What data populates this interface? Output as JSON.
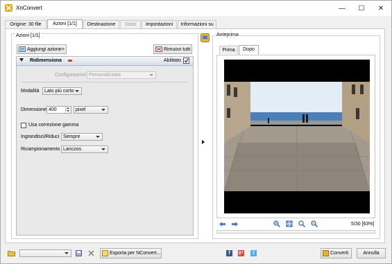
{
  "window": {
    "title": "XnConvert",
    "minimize": "—",
    "maximize": "☐",
    "close": "✕"
  },
  "tabs": [
    {
      "label": "Origine: 30 file"
    },
    {
      "label": "Azioni [1/1]"
    },
    {
      "label": "Destinazione"
    },
    {
      "label": "Stato"
    },
    {
      "label": "Impostazioni"
    },
    {
      "label": "Informazioni su"
    }
  ],
  "actions": {
    "group_title": "Azioni [1/1]",
    "add_button": "Aggiungi azione>",
    "remove_all_button": "Rimuovi tutti",
    "item": {
      "name": "Ridimensiona",
      "enabled_label": "Abilitato",
      "enabled": true,
      "config_label": "Configurazioni",
      "config_value": "Personalizzata",
      "mode_label": "Modalità",
      "mode_value": "Lato più corto",
      "dimension_label": "Dimensione",
      "dimension_value": "400",
      "unit_value": "pixel",
      "gamma_label": "Usa correzione gamma",
      "gamma_checked": false,
      "enlarge_label": "Ingrandisci/Riduci",
      "enlarge_value": "Sempre",
      "resample_label": "Ricampionamento",
      "resample_value": "Lanczos"
    }
  },
  "preview": {
    "group_title": "Anteprima",
    "tabs": [
      {
        "label": "Prima"
      },
      {
        "label": "Dopo"
      }
    ],
    "counter": "5/30 [63%]"
  },
  "bottom": {
    "export_label": "Esporta per NConvert...",
    "convert_label": "Converti",
    "cancel_label": "Annulla"
  },
  "colors": {
    "accent": "#3d6db5",
    "facebook": "#3b5998",
    "google": "#dd4b39",
    "twitter": "#55acee"
  }
}
